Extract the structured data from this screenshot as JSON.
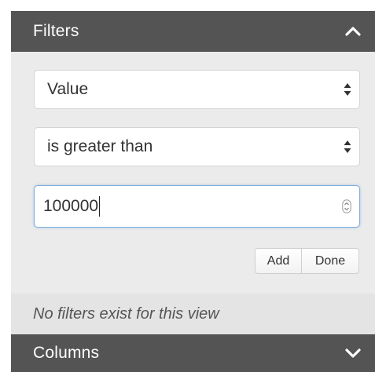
{
  "filters_panel": {
    "title": "Filters",
    "collapse_icon": "chevron-up-icon",
    "field_select": {
      "value": "Value",
      "icon": "sort-arrows-icon"
    },
    "operator_select": {
      "value": "is greater than",
      "icon": "sort-arrows-icon"
    },
    "value_input": {
      "value": "100000",
      "icon": "spinner-icon"
    },
    "buttons": {
      "add_label": "Add",
      "done_label": "Done"
    },
    "empty_message": "No filters exist for this view"
  },
  "columns_panel": {
    "title": "Columns",
    "expand_icon": "chevron-down-icon"
  },
  "colors": {
    "header_bg": "#545454",
    "panel_bg": "#ebebeb",
    "focus_border": "#7eaee0"
  }
}
